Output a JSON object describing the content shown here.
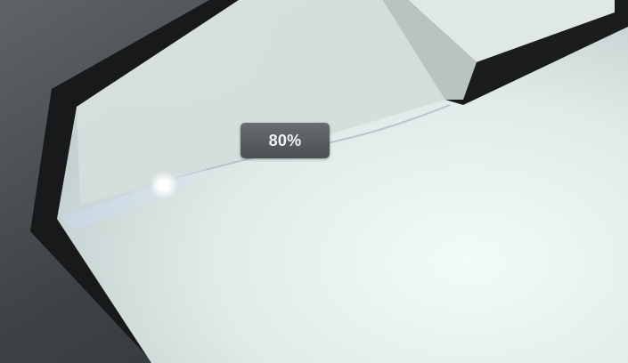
{
  "zoom_indicator": {
    "label": "80%",
    "value_percent": 80
  },
  "colors": {
    "badge_bg": "#585c5e",
    "badge_text": "#f2f4f5",
    "ceiling_white": "#e6f1ef",
    "frame_black": "#17191a",
    "shadow_gray": "#3a3e40"
  }
}
